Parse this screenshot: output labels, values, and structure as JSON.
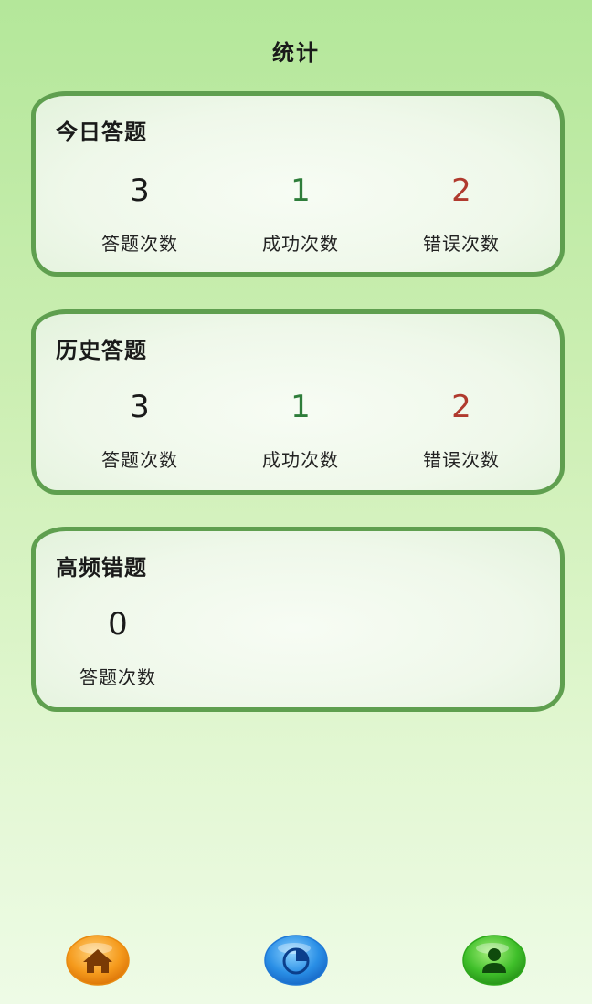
{
  "page": {
    "title": "统计"
  },
  "colors": {
    "success": "#2e7d3a",
    "error": "#b03a2e",
    "default": "#1a1a1a"
  },
  "today": {
    "title": "今日答题",
    "stats": [
      {
        "value": "3",
        "label": "答题次数"
      },
      {
        "value": "1",
        "label": "成功次数"
      },
      {
        "value": "2",
        "label": "错误次数"
      }
    ]
  },
  "history": {
    "title": "历史答题",
    "stats": [
      {
        "value": "3",
        "label": "答题次数"
      },
      {
        "value": "1",
        "label": "成功次数"
      },
      {
        "value": "2",
        "label": "错误次数"
      }
    ]
  },
  "frequent_errors": {
    "title": "高频错题",
    "stats": [
      {
        "value": "0",
        "label": "答题次数"
      }
    ]
  },
  "bottom_nav": {
    "items": [
      {
        "icon": "home-icon"
      },
      {
        "icon": "statistics-pie-icon"
      },
      {
        "icon": "user-profile-icon"
      }
    ]
  }
}
